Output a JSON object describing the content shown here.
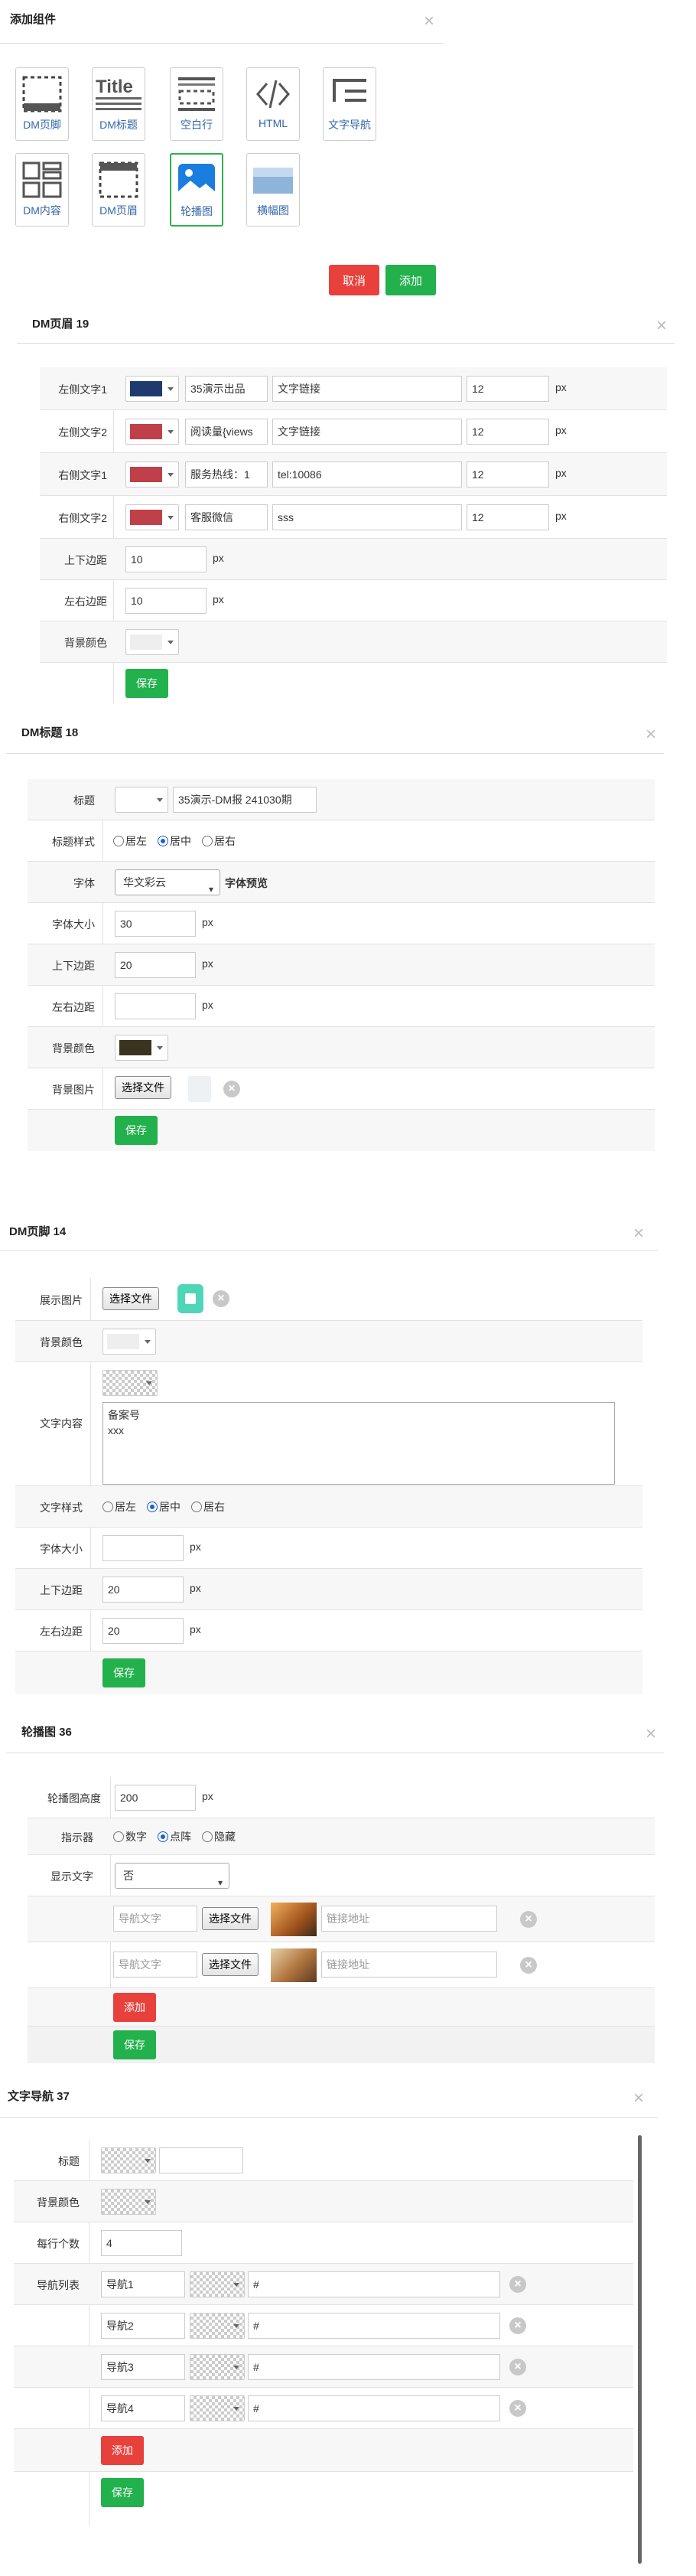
{
  "add_panel": {
    "title": "添加组件",
    "components": [
      {
        "label": "DM页脚",
        "icon": "footer-icon"
      },
      {
        "label": "DM标题",
        "icon": "title-icon"
      },
      {
        "label": "空白行",
        "icon": "blank-row-icon"
      },
      {
        "label": "HTML",
        "icon": "code-icon"
      },
      {
        "label": "文字导航",
        "icon": "text-nav-icon"
      },
      {
        "label": "DM内容",
        "icon": "content-icon"
      },
      {
        "label": "DM页眉",
        "icon": "header-icon"
      },
      {
        "label": "轮播图",
        "icon": "carousel-icon",
        "selected": true
      },
      {
        "label": "横幅图",
        "icon": "banner-icon"
      }
    ],
    "cancel_label": "取消",
    "add_label": "添加"
  },
  "header_panel": {
    "title": "DM页眉 19",
    "rows": [
      {
        "label": "左侧文字1",
        "color": "#1f3a6e",
        "text": "35演示出品",
        "link": "文字链接",
        "size": "12"
      },
      {
        "label": "左侧文字2",
        "color": "#c0404a",
        "text": "阅读量{views",
        "link": "文字链接",
        "size": "12"
      },
      {
        "label": "右侧文字1",
        "color": "#c0404a",
        "text": "服务热线：1",
        "link": "tel:10086",
        "size": "12"
      },
      {
        "label": "右侧文字2",
        "color": "#c0404a",
        "text": "客服微信",
        "link": "sss",
        "size": "12"
      }
    ],
    "px": "px",
    "padding_v_label": "上下边距",
    "padding_v": "10",
    "padding_h_label": "左右边距",
    "padding_h": "10",
    "bg_label": "背景颜色",
    "bg_color": "#eeeeee",
    "save_label": "保存"
  },
  "title_panel": {
    "title": "DM标题 18",
    "title_label": "标题",
    "title_value": "35演示-DM报 241030期",
    "style_label": "标题样式",
    "style_options": [
      "居左",
      "居中",
      "居右"
    ],
    "style_selected": 1,
    "font_label": "字体",
    "font_value": "华文彩云",
    "font_preview": "字体预览",
    "size_label": "字体大小",
    "size_value": "30",
    "pv_label": "上下边距",
    "pv_value": "20",
    "ph_label": "左右边距",
    "ph_value": "",
    "bg_label": "背景颜色",
    "bg_color": "#3a3320",
    "bgimg_label": "背景图片",
    "file_label": "选择文件",
    "save_label": "保存"
  },
  "footer_panel": {
    "title": "DM页脚 14",
    "img_label": "展示图片",
    "file_label": "选择文件",
    "bg_label": "背景颜色",
    "content_label": "文字内容",
    "content_text": "备案号\nxxx",
    "style_label": "文字样式",
    "style_options": [
      "居左",
      "居中",
      "居右"
    ],
    "style_selected": 1,
    "size_label": "字体大小",
    "size_value": "",
    "pv_label": "上下边距",
    "pv_value": "20",
    "ph_label": "左右边距",
    "ph_value": "20",
    "save_label": "保存"
  },
  "carousel_panel": {
    "title": "轮播图 36",
    "height_label": "轮播图高度",
    "height_value": "200",
    "indicator_label": "指示器",
    "indicator_options": [
      "数字",
      "点阵",
      "隐藏"
    ],
    "indicator_selected": 1,
    "showtext_label": "显示文字",
    "showtext_value": "否",
    "items": [
      {
        "nav_placeholder": "导航文字",
        "file_label": "选择文件",
        "link_placeholder": "链接地址"
      },
      {
        "nav_placeholder": "导航文字",
        "file_label": "选择文件",
        "link_placeholder": "链接地址"
      }
    ],
    "add_label": "添加",
    "save_label": "保存"
  },
  "textnav_panel": {
    "title": "文字导航 37",
    "title_label": "标题",
    "bg_label": "背景颜色",
    "per_row_label": "每行个数",
    "per_row_value": "4",
    "list_label": "导航列表",
    "items": [
      {
        "name": "导航1",
        "link": "#"
      },
      {
        "name": "导航2",
        "link": "#"
      },
      {
        "name": "导航3",
        "link": "#"
      },
      {
        "name": "导航4",
        "link": "#"
      }
    ],
    "add_label": "添加",
    "save_label": "保存"
  },
  "px": "px",
  "colors": {
    "red": "#e8413c",
    "green": "#22b14c",
    "link_blue": "#3366aa"
  }
}
